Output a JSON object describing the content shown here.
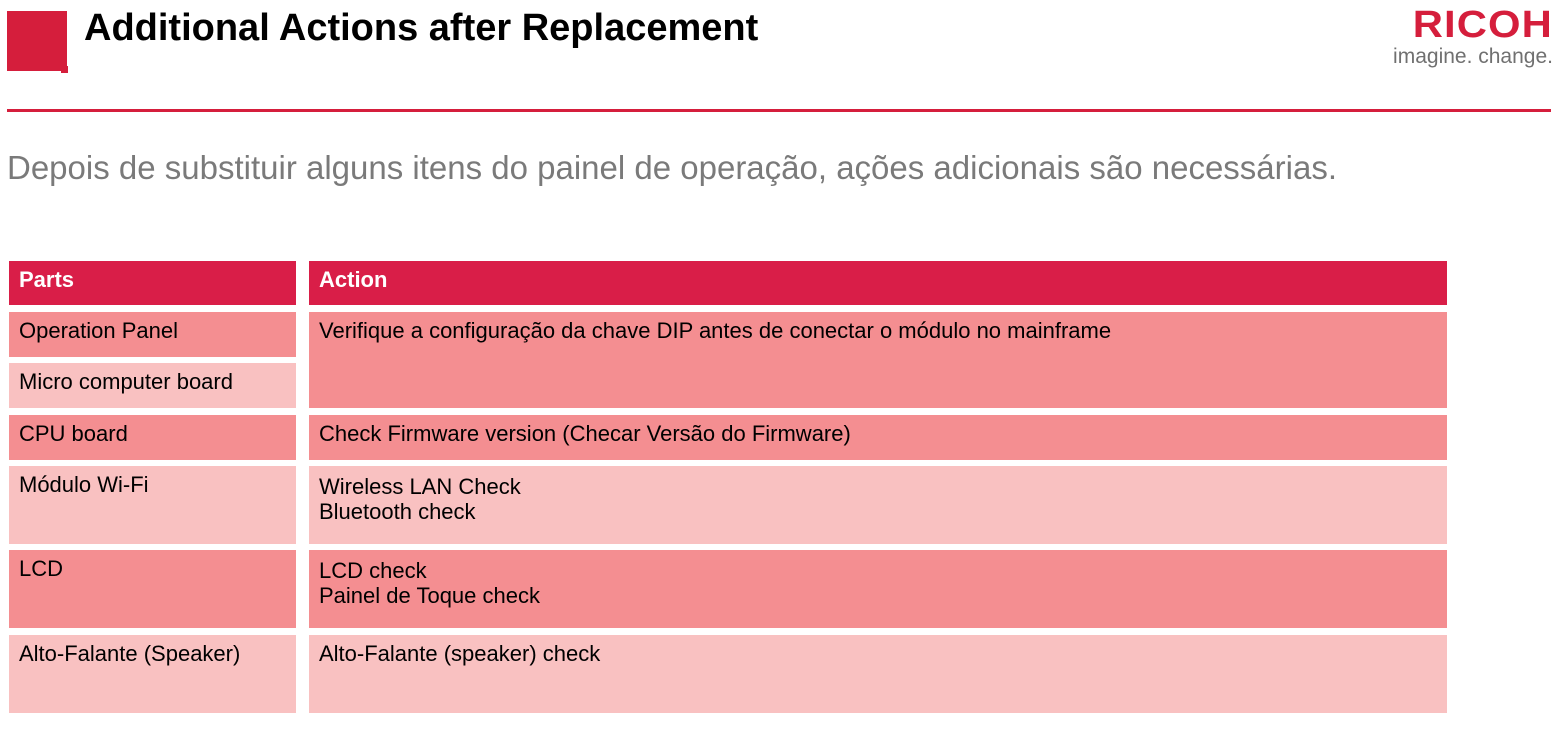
{
  "header": {
    "title": "Additional Actions after Replacement",
    "logo_word": "RICOH",
    "logo_tagline": "imagine. change."
  },
  "subtitle": "Depois de substituir alguns itens do painel de operação, ações adicionais são necessárias.",
  "colors": {
    "accent": "#d51e3c",
    "header_row": "#d91e48",
    "row_dark": "#f48e91",
    "row_light": "#f9c1c1",
    "subtitle_text": "#7a7a7a"
  },
  "table": {
    "headers": {
      "parts": "Parts",
      "action": "Action"
    },
    "parts": [
      "Operation Panel",
      "Micro computer board",
      "CPU board",
      "Módulo Wi-Fi",
      "LCD",
      "Alto-Falante (Speaker)"
    ],
    "actions": [
      [
        "Verifique a configuração da chave DIP antes de conectar o módulo no mainframe"
      ],
      [
        "Check Firmware version (Checar Versão do Firmware)"
      ],
      [
        "Wireless LAN Check",
        "Bluetooth check"
      ],
      [
        "LCD check",
        "Painel de Toque check"
      ],
      [
        "Alto-Falante (speaker) check"
      ]
    ]
  }
}
